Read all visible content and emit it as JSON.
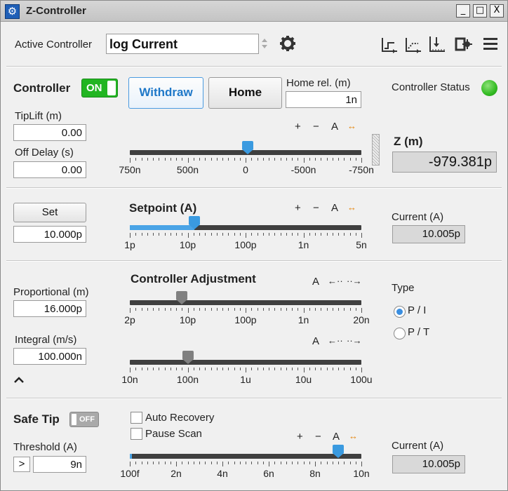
{
  "window": {
    "title": "Z-Controller",
    "min": "_",
    "max": "□",
    "close": "X"
  },
  "toolbar": {
    "active_label": "Active Controller",
    "active_value": "log Current"
  },
  "controller": {
    "label": "Controller",
    "toggle": "ON",
    "withdraw": "Withdraw",
    "home": "Home",
    "home_rel_label": "Home rel. (m)",
    "home_rel_value": "1n",
    "status_label": "Controller Status",
    "status_color": "#33bb22",
    "tiplift_label": "TipLift (m)",
    "tiplift_value": "0.00",
    "offdelay_label": "Off Delay (s)",
    "offdelay_value": "0.00",
    "z_label": "Z (m)",
    "z_value": "-979.381p",
    "slider_ctrls": [
      "+",
      "−",
      "A",
      "↔"
    ],
    "z_slider": {
      "fraction": 0.51,
      "ticks": [
        "750n",
        "500n",
        "0",
        "-500n",
        "-750n"
      ]
    }
  },
  "setpoint": {
    "set": "Set",
    "value": "10.000p",
    "label": "Setpoint (A)",
    "slider_ctrls": [
      "+",
      "−",
      "A",
      "↔"
    ],
    "slider": {
      "fraction": 0.28,
      "ticks": [
        "1p",
        "10p",
        "100p",
        "1n",
        "5n"
      ]
    },
    "current_label": "Current (A)",
    "current_value": "10.005p"
  },
  "adjust": {
    "title": "Controller Adjustment",
    "prop_label": "Proportional (m)",
    "prop_value": "16.000p",
    "int_label": "Integral (m/s)",
    "int_value": "100.000n",
    "ctrls": [
      "A",
      "←··",
      "··→"
    ],
    "prop_slider": {
      "fraction": 0.225,
      "ticks": [
        "2p",
        "10p",
        "100p",
        "1n",
        "20n"
      ]
    },
    "int_slider": {
      "fraction": 0.25,
      "ticks": [
        "10n",
        "100n",
        "1u",
        "10u",
        "100u"
      ]
    },
    "type_label": "Type",
    "type_options": [
      "P / I",
      "P / T"
    ],
    "type_selected": "P / I",
    "collapse": "^"
  },
  "safetip": {
    "label": "Safe Tip",
    "toggle": "OFF",
    "auto_recovery": "Auto Recovery",
    "pause_scan": "Pause Scan",
    "threshold_label": "Threshold (A)",
    "threshold_op": ">",
    "threshold_value": "9n",
    "slider_ctrls": [
      "+",
      "−",
      "A",
      "↔"
    ],
    "slider": {
      "fraction": 0.9,
      "ticks": [
        "100f",
        "2n",
        "4n",
        "6n",
        "8n",
        "10n"
      ]
    },
    "current_label": "Current (A)",
    "current_value": "10.005p"
  }
}
